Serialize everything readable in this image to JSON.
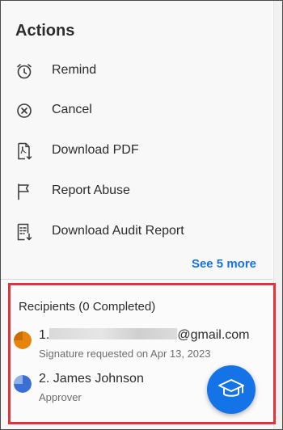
{
  "panel": {
    "title": "Actions"
  },
  "actions": [
    {
      "label": "Remind",
      "icon": "alarm-clock-icon"
    },
    {
      "label": "Cancel",
      "icon": "cancel-circle-icon"
    },
    {
      "label": "Download PDF",
      "icon": "download-pdf-icon"
    },
    {
      "label": "Report Abuse",
      "icon": "flag-icon"
    },
    {
      "label": "Download Audit Report",
      "icon": "audit-report-icon"
    }
  ],
  "see_more": "See 5 more",
  "recipients": {
    "title": "Recipients (0 Completed)",
    "items": [
      {
        "index": "1.",
        "email_suffix": "@gmail.com",
        "status": "Signature requested on Apr 13, 2023",
        "color": "#e8840c"
      },
      {
        "name": "2. James Johnson",
        "role": "Approver",
        "color": "#3b6fd4"
      }
    ]
  },
  "fab": {
    "icon": "graduation-cap-icon",
    "color": "#1473e6"
  }
}
